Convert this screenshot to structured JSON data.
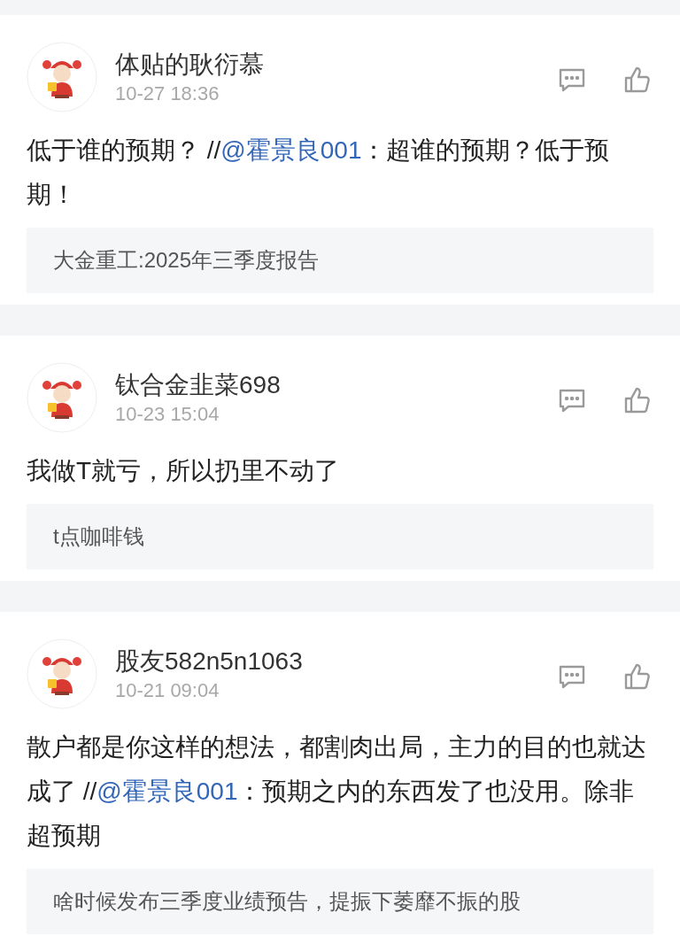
{
  "comments": [
    {
      "user": "体贴的耿衍慕",
      "time": "10-27 18:36",
      "content": [
        {
          "kind": "text",
          "text": "低于谁的预期？ //"
        },
        {
          "kind": "mention",
          "text": "@霍景良001"
        },
        {
          "kind": "text",
          "text": "：超谁的预期？低于预期！"
        }
      ],
      "quote": "大金重工:2025年三季度报告"
    },
    {
      "user": "钛合金韭菜698",
      "time": "10-23 15:04",
      "content": [
        {
          "kind": "text",
          "text": "我做T就亏，所以扔里不动了"
        }
      ],
      "quote": "t点咖啡钱"
    },
    {
      "user": "股友582n5n1063",
      "time": "10-21 09:04",
      "content": [
        {
          "kind": "text",
          "text": "散户都是你这样的想法，都割肉出局，主力的目的也就达成了 //"
        },
        {
          "kind": "mention",
          "text": "@霍景良001"
        },
        {
          "kind": "text",
          "text": "：预期之内的东西发了也没用。除非超预期"
        }
      ],
      "quote": "啥时候发布三季度业绩预告，提振下萎靡不振的股"
    }
  ]
}
